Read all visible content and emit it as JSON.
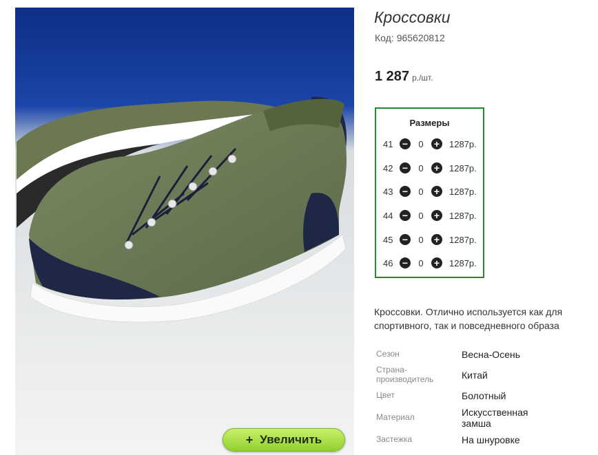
{
  "product": {
    "title": "Кроссовки",
    "code_label": "Код:",
    "code": "965620812",
    "price": "1 287",
    "price_unit": "р./шт.",
    "description": "Кроссовки. Отлично используется как для спортивного, так и повседневного образа"
  },
  "zoom_button": {
    "icon": "plus-icon",
    "label": "Увеличить"
  },
  "sizes": {
    "header": "Размеры",
    "rows": [
      {
        "size": "41",
        "qty": "0",
        "price": "1287р."
      },
      {
        "size": "42",
        "qty": "0",
        "price": "1287р."
      },
      {
        "size": "43",
        "qty": "0",
        "price": "1287р."
      },
      {
        "size": "44",
        "qty": "0",
        "price": "1287р."
      },
      {
        "size": "45",
        "qty": "0",
        "price": "1287р."
      },
      {
        "size": "46",
        "qty": "0",
        "price": "1287р."
      }
    ]
  },
  "properties": [
    {
      "key": "Сезон",
      "value": "Весна-Осень"
    },
    {
      "key": "Страна-производитель",
      "value": "Китай"
    },
    {
      "key": "Цвет",
      "value": "Болотный"
    },
    {
      "key": "Материал",
      "value": "Искусственная замша"
    },
    {
      "key": "Застежка",
      "value": "На шнуровке"
    }
  ],
  "colors": {
    "border_green": "#1e8c2a",
    "button_green": "#a6e044",
    "shoe_green": "#6e7d56",
    "accent_navy": "#1f2746"
  }
}
